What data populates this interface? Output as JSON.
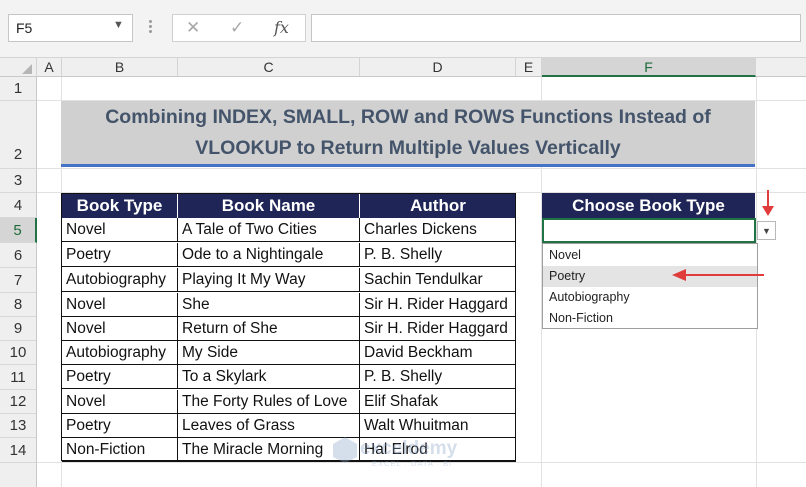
{
  "formula_bar": {
    "name_box": "F5",
    "cancel_icon": "✕",
    "enter_icon": "✓",
    "fx_label": "fx",
    "formula": ""
  },
  "columns": [
    {
      "name": "A"
    },
    {
      "name": "B"
    },
    {
      "name": "C"
    },
    {
      "name": "D"
    },
    {
      "name": "E"
    },
    {
      "name": "F"
    }
  ],
  "rows": [
    "1",
    "2",
    "3",
    "4",
    "5",
    "6",
    "7",
    "8",
    "9",
    "10",
    "11",
    "12",
    "13",
    "14"
  ],
  "title": {
    "line1": "Combining INDEX, SMALL, ROW and ROWS Functions Instead of",
    "line2": "VLOOKUP to Return Multiple Values Vertically"
  },
  "table": {
    "headers": [
      "Book Type",
      "Book Name",
      "Author"
    ],
    "rows": [
      [
        "Novel",
        "A Tale of Two Cities",
        "Charles Dickens"
      ],
      [
        "Poetry",
        "Ode to a Nightingale",
        "P. B. Shelly"
      ],
      [
        "Autobiography",
        "Playing It My Way",
        "Sachin Tendulkar"
      ],
      [
        "Novel",
        "She",
        "Sir H. Rider Haggard"
      ],
      [
        "Novel",
        "Return of She",
        "Sir H. Rider Haggard"
      ],
      [
        "Autobiography",
        "My Side",
        "David Beckham"
      ],
      [
        "Poetry",
        "To a Skylark",
        "P. B. Shelly"
      ],
      [
        "Novel",
        "The Forty Rules of Love",
        "Elif Shafak"
      ],
      [
        "Poetry",
        "Leaves of Grass",
        "Walt Whuitman"
      ],
      [
        "Non-Fiction",
        "The Miracle Morning",
        "Hal Elrod"
      ]
    ]
  },
  "chooser": {
    "header": "Choose Book Type",
    "value": "",
    "options": [
      "Novel",
      "Poetry",
      "Autobiography",
      "Non-Fiction"
    ],
    "highlighted": "Poetry"
  },
  "watermark": {
    "name": "exceldemy",
    "tagline": "EXCEL · DATA · BI"
  },
  "colors": {
    "header_fill": "#1f2557",
    "title_text": "#44546a",
    "title_fill": "#d0d0d0",
    "accent_blue": "#4472c4",
    "selection_green": "#217346",
    "annotation_red": "#e03c3c"
  }
}
